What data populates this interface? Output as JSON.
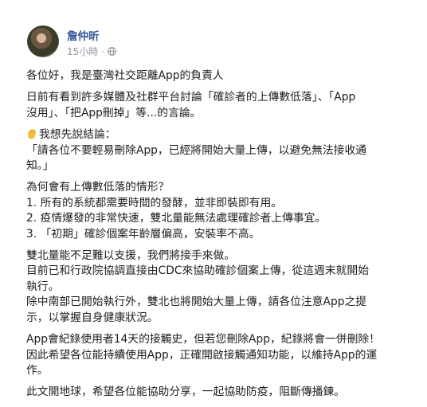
{
  "author": {
    "name": "詹仲昕"
  },
  "meta": {
    "time": "15小時",
    "separator": "·",
    "privacy_icon": "globe-icon"
  },
  "post": {
    "p1": "各位好，我是臺灣社交距離App的負責人",
    "p2": [
      "日前有看到許多媒體及社群平台討論「確診者的上傳數低落」、「App",
      "沒用」、「把App刪掉」等...的言論。"
    ],
    "p3": {
      "icon": "raised-hand-emoji-icon",
      "lines": [
        "我想先說結論：",
        "「請各位不要輕易刪除App，已經將開始大量上傳，以避免無法接收通",
        "知。」"
      ]
    },
    "p4": [
      "為何會有上傳數低落的情形？",
      "1. 所有的系統都需要時間的發酵，並非即裝即有用。",
      "2. 疫情爆發的非常快速，雙北量能無法處理確診者上傳事宜。",
      "3. 「初期」確診個案年齡層偏高，安裝率不高。"
    ],
    "p5": [
      "雙北量能不足難以支援，我們將接手來做。",
      "目前已和行政院協調直接由CDC來協助確診個案上傳，從這週末就開始",
      "執行。",
      "除中南部已開始執行外，雙北也將開始大量上傳，請各位注意App之提",
      "示，以掌握自身健康狀況。"
    ],
    "p6": [
      "App會紀錄使用者14天的接觸史，但若您刪除App，紀錄將會一併刪除！",
      "因此希望各位能持續使用App，正確開啟接觸通知功能，以維持App的運",
      "作。"
    ],
    "p7": "此文開地球，希望各位能協助分享，一起協助防疫，阻斷傳播鍊。"
  }
}
